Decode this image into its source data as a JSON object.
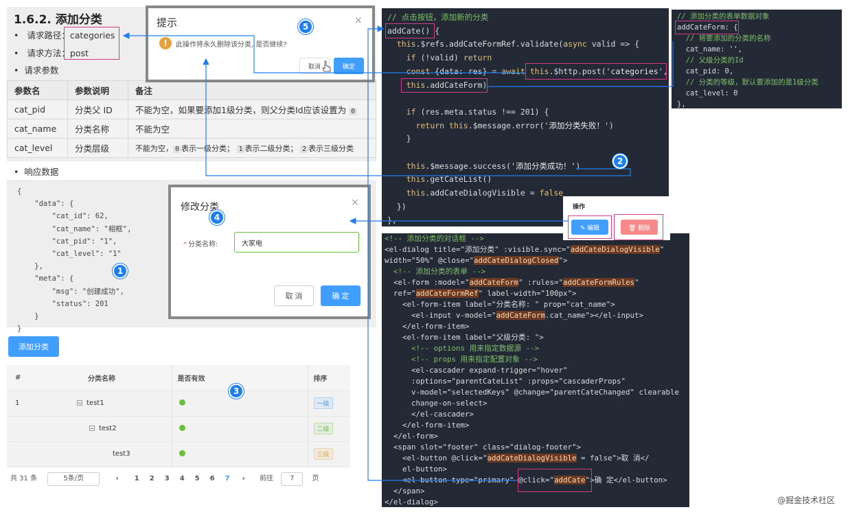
{
  "doc": {
    "title": "1.6.2. 添加分类",
    "path_label": "请求路径：",
    "path_value": "categories",
    "method_label": "请求方法：",
    "method_value": "post",
    "params_label": "请求参数",
    "table_headers": [
      "参数名",
      "参数说明",
      "备注"
    ],
    "rows": [
      {
        "name": "cat_pid",
        "desc": "分类父 ID",
        "note_pre": "不能为空，如果要添加1级分类，则父分类Id应该设置为",
        "chips": [
          "0"
        ],
        "note_post": ""
      },
      {
        "name": "cat_name",
        "desc": "分类名称",
        "note_pre": "不能为空",
        "chips": [],
        "note_post": ""
      },
      {
        "name": "cat_level",
        "desc": "分类层级",
        "note_pre": "不能为空，",
        "chips": [
          "0",
          "1",
          "2"
        ],
        "chip_texts": [
          "表示一级分类；",
          "表示二级分类；",
          "表示三级分类"
        ],
        "note_post": ""
      }
    ],
    "response_label": "响应数据"
  },
  "response_json": [
    "{",
    "    \"data\": {",
    "        \"cat_id\": 62,",
    "        \"cat_name\": \"相框\",",
    "        \"cat_pid\": \"1\",",
    "        \"cat_level\": \"1\"",
    "    },",
    "    \"meta\": {",
    "        \"msg\": \"创建成功\",",
    "        \"status\": 201",
    "    }",
    "}"
  ],
  "category_table": {
    "add_button": "添加分类",
    "headers": [
      "#",
      "分类名称",
      "是否有效",
      "排序"
    ],
    "rows": [
      {
        "index": "1",
        "name": "test1",
        "level": "一级",
        "level_color": "#409eff",
        "indent": 0,
        "tree": true
      },
      {
        "index": "",
        "name": "test2",
        "level": "二级",
        "level_color": "#67c23a",
        "indent": 1,
        "tree": true
      },
      {
        "index": "",
        "name": "test3",
        "level": "三级",
        "level_color": "#e6a23c",
        "indent": 2,
        "tree": false
      }
    ],
    "pager": {
      "total": "共 31 条",
      "page_size": "5条/页",
      "prev": "‹",
      "pages": [
        "1",
        "2",
        "3",
        "4",
        "5",
        "6",
        "7"
      ],
      "next": "›",
      "goto_label": "前往",
      "goto_value": "7",
      "goto_suffix": "页"
    }
  },
  "confirm_dialog": {
    "title": "提示",
    "close": "×",
    "icon": "!",
    "message": "此操作将永久删除该分类, 是否继续?",
    "cancel": "取消",
    "ok": "确定"
  },
  "edit_dialog": {
    "title": "修改分类",
    "close": "×",
    "label_required": "*",
    "label": "分类名称:",
    "value": "大家电",
    "cancel": "取 消",
    "ok": "确 定"
  },
  "ops_popup": {
    "title": "操作",
    "edit": "✎ 编辑",
    "delete": "🗑 删除"
  },
  "code_method": [
    "// 点击按钮，添加新的分类",
    "addCate() {",
    "  this.$refs.addCateFormRef.validate(async valid => {",
    "    if (!valid) return",
    "    const {data: res} = await this.$http.post('categories',",
    "    this.addCateForm)",
    "",
    "    if (res.meta.status !== 201) {",
    "      return this.$message.error('添加分类失败！')",
    "    }",
    "",
    "    this.$message.success('添加分类成功！')",
    "    this.getCateList()",
    "    this.addCateDialogVisible = false",
    "  })",
    "},"
  ],
  "code_data": [
    "// 添加分类的表单数据对象",
    "addCateForm: {",
    "  // 将要添加的分类的名称",
    "  cat_name: '',",
    "  // 父级分类的Id",
    "  cat_pid: 0,",
    "  // 分类的等级，默认要添加的是1级分类",
    "  cat_level: 0",
    "},"
  ],
  "code_template": [
    "<!-- 添加分类的对话框 -->",
    "<el-dialog title=\"添加分类\" :visible.sync=\"addCateDialogVisible\"",
    "width=\"50%\" @close=\"addCateDialogClosed\">",
    "  <!-- 添加分类的表单 -->",
    "  <el-form :model=\"addCateForm\" :rules=\"addCateFormRules\"",
    "  ref=\"addCateFormRef\" label-width=\"100px\">",
    "    <el-form-item label=\"分类名称: \" prop=\"cat_name\">",
    "      <el-input v-model=\"addCateForm.cat_name\"></el-input>",
    "    </el-form-item>",
    "    <el-form-item label=\"父级分类: \">",
    "      <!-- options 用来指定数据源 -->",
    "      <!-- props 用来指定配置对象 -->",
    "      <el-cascader expand-trigger=\"hover\"",
    "      :options=\"parentCateList\" :props=\"cascaderProps\"",
    "      v-model=\"selectedKeys\" @change=\"parentCateChanged\" clearable",
    "      change-on-select>",
    "      </el-cascader>",
    "    </el-form-item>",
    "  </el-form>",
    "  <span slot=\"footer\" class=\"dialog-footer\">",
    "    <el-button @click=\"addCateDialogVisible = false\">取 消</",
    "    el-button>",
    "    <el-button type=\"primary\" @click=\"addCate\">确 定</el-button>",
    "  </span>",
    "</el-dialog>"
  ],
  "badges": [
    "1",
    "2",
    "3",
    "4",
    "5"
  ],
  "watermark": "@掘金技术社区",
  "colors": {
    "accent": "#409eff",
    "annotation_box": "#d63a8a",
    "arrow": "#1e7ef0",
    "code_bg": "#232a35"
  }
}
